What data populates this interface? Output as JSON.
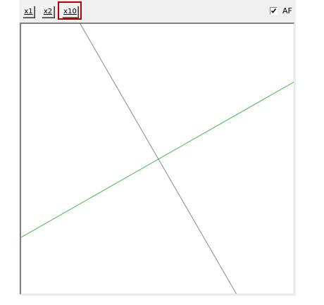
{
  "toolbar": {
    "zoom_x1_label": "x1",
    "zoom_x2_label": "x2",
    "zoom_x10_label": "x10",
    "selected_zoom": "x10",
    "af_label": "AF",
    "af_checked": true
  },
  "colors": {
    "highlight": "#c00000",
    "green_line": "#44bb44",
    "gray_line": "#888888"
  },
  "icons": [
    "checkmark-icon"
  ]
}
